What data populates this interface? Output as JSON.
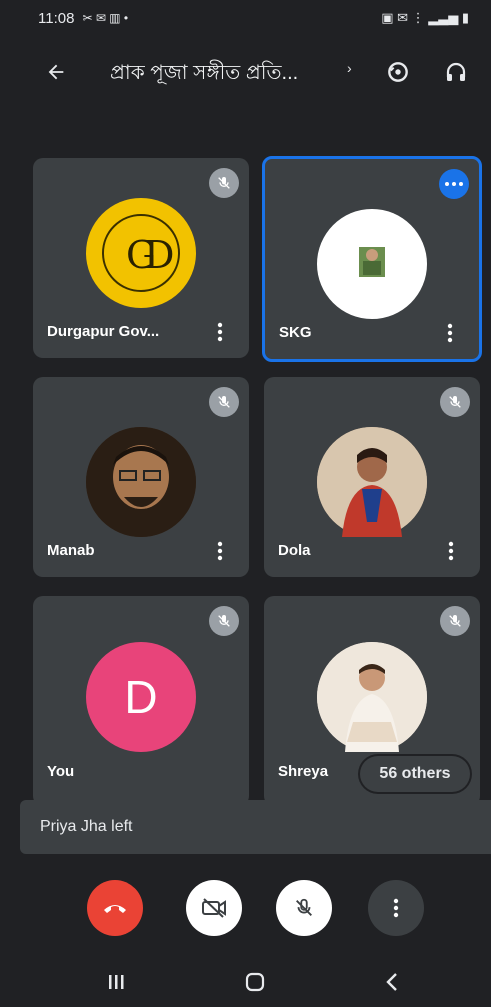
{
  "status_bar": {
    "time": "11:08",
    "indicators": "✂ ✉ ▥ •",
    "system_icons": "▣ ✉ ⋮ ▂▃▅ ▮"
  },
  "app_bar": {
    "title": "প্রাক পূজা সঙ্গীত প্রতি...",
    "chevron": "›"
  },
  "participants": [
    {
      "name": "Durgapur Gov...",
      "muted": true,
      "speaking": false,
      "avatar": "logo"
    },
    {
      "name": "SKG",
      "muted": false,
      "speaking": true,
      "avatar": "photo"
    },
    {
      "name": "Manab",
      "muted": true,
      "speaking": false,
      "avatar": "photo"
    },
    {
      "name": "Dola",
      "muted": true,
      "speaking": false,
      "avatar": "photo"
    },
    {
      "name": "You",
      "muted": true,
      "speaking": false,
      "avatar": "letter",
      "letter": "D"
    },
    {
      "name": "Shreya",
      "muted": true,
      "speaking": false,
      "avatar": "photo"
    }
  ],
  "others_chip": "56 others",
  "toast": "Priya Jha left",
  "colors": {
    "background": "#202124",
    "tile": "#3c4043",
    "active_border": "#1a73e8",
    "end_call": "#ea4335",
    "you_avatar": "#e8447a"
  },
  "icons": [
    "back-arrow-icon",
    "switch-camera-icon",
    "headphones-icon",
    "mic-off-icon",
    "more-vert-icon",
    "end-call-icon",
    "camera-off-icon",
    "nav-recents-icon",
    "nav-home-icon",
    "nav-back-icon"
  ]
}
